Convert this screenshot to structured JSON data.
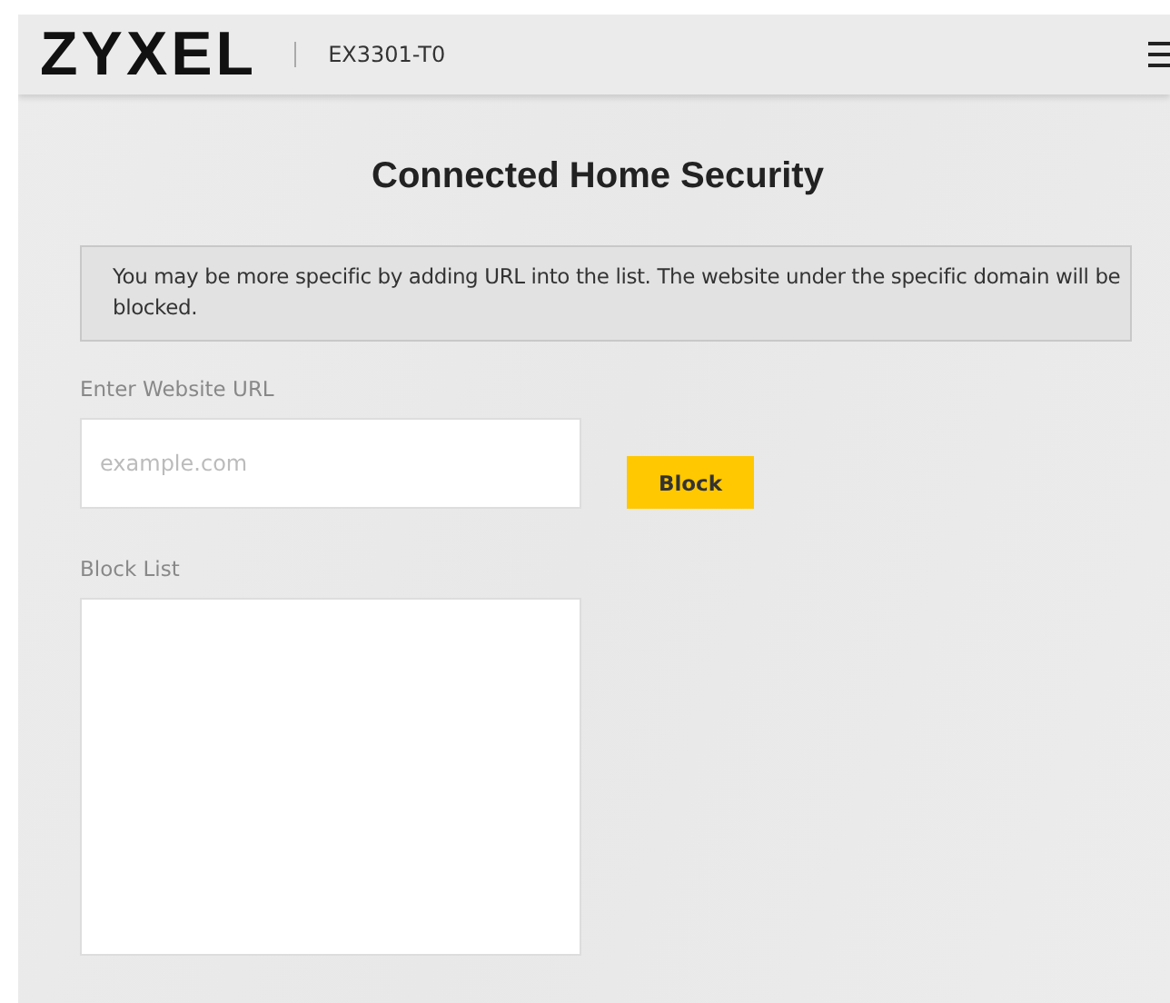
{
  "header": {
    "logo": "ZYXEL",
    "model": "EX3301-T0"
  },
  "title": "Connected Home Security",
  "notice": "You may be more specific by adding URL into the list. The website under the specific domain will be blocked.",
  "url_field": {
    "label": "Enter Website URL",
    "placeholder": "example.com"
  },
  "block_button": "Block",
  "block_list": {
    "label": "Block List"
  }
}
